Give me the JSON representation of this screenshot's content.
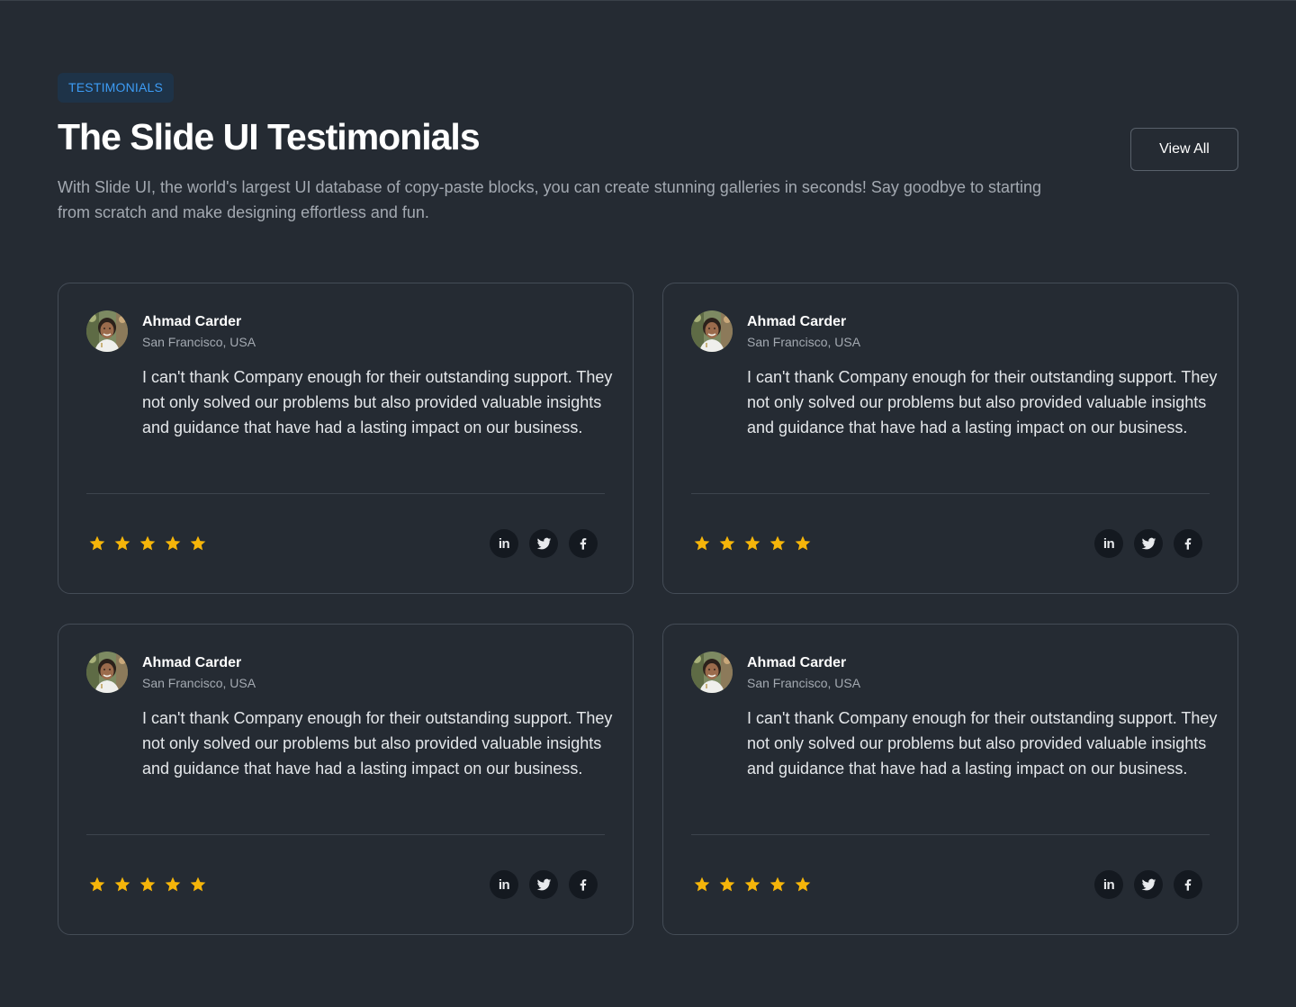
{
  "header": {
    "badge": "TESTIMONIALS",
    "title": "The Slide UI Testimonials",
    "subtitle": "With Slide UI, the world's largest UI database of copy-paste blocks, you can create stunning galleries in seconds! Say goodbye to starting from scratch and make designing effortless and fun.",
    "view_all_label": "View All"
  },
  "colors": {
    "background": "#252b33",
    "badge_text": "#3d9cf5",
    "badge_bg": "#1e3348",
    "star": "#f5b50a",
    "social_bg": "#141920"
  },
  "testimonials": [
    {
      "name": "Ahmad Carder",
      "location": "San Francisco, USA",
      "quote": "I can't thank Company enough for their outstanding support. They not only solved our problems but also provided valuable insights and guidance that have had a lasting impact on our business.",
      "rating": 5,
      "socials": [
        "linkedin-icon",
        "twitter-icon",
        "facebook-icon"
      ]
    },
    {
      "name": "Ahmad Carder",
      "location": "San Francisco, USA",
      "quote": "I can't thank Company enough for their outstanding support. They not only solved our problems but also provided valuable insights and guidance that have had a lasting impact on our business.",
      "rating": 5,
      "socials": [
        "linkedin-icon",
        "twitter-icon",
        "facebook-icon"
      ]
    },
    {
      "name": "Ahmad Carder",
      "location": "San Francisco, USA",
      "quote": "I can't thank Company enough for their outstanding support. They not only solved our problems but also provided valuable insights and guidance that have had a lasting impact on our business.",
      "rating": 5,
      "socials": [
        "linkedin-icon",
        "twitter-icon",
        "facebook-icon"
      ]
    },
    {
      "name": "Ahmad Carder",
      "location": "San Francisco, USA",
      "quote": "I can't thank Company enough for their outstanding support. They not only solved our problems but also provided valuable insights and guidance that have had a lasting impact on our business.",
      "rating": 5,
      "socials": [
        "linkedin-icon",
        "twitter-icon",
        "facebook-icon"
      ]
    }
  ]
}
